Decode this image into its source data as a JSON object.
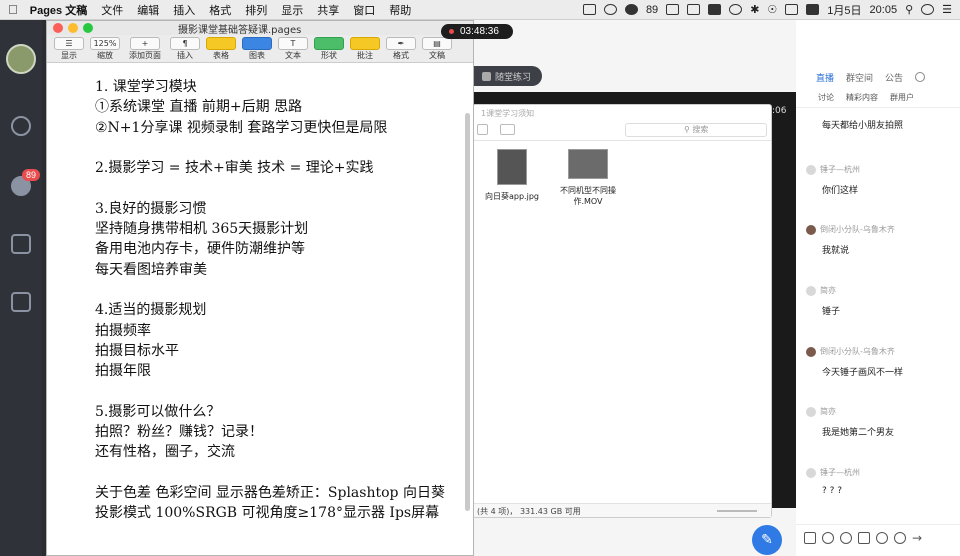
{
  "menubar": {
    "app": "Pages 文稿",
    "items": [
      "文件",
      "编辑",
      "插入",
      "格式",
      "排列",
      "显示",
      "共享",
      "窗口",
      "帮助"
    ],
    "battery_label": "89",
    "date": "1月5日",
    "time": "20:05"
  },
  "recording": {
    "time": "03:48:36"
  },
  "pages": {
    "title": "摄影课堂基础答疑课.pages",
    "zoom": "125%",
    "toolbar": [
      "显示",
      "缩放",
      "添加页面",
      "插入",
      "表格",
      "图表",
      "文本",
      "形状",
      "批注",
      "格式",
      "文稿"
    ],
    "lines": [
      "1. 课堂学习模块",
      "①系统课堂  直播  前期+后期  思路",
      "②N+1分享课  视频录制  套路学习更快但是局限",
      "",
      "2.摄影学习 = 技术+审美   技术 = 理论+实践",
      "",
      "3.良好的摄影习惯",
      "坚持随身携带相机   365天摄影计划",
      "备用电池内存卡，硬件防潮维护等",
      "每天看图培养审美",
      "",
      "4.适当的摄影规划",
      "拍摄频率",
      "拍摄目标水平",
      "拍摄年限",
      "",
      "5.摄影可以做什么？",
      "拍照？粉丝？赚钱？记录！",
      "还有性格，圈子，交流",
      "",
      "关于色差  色彩空间  显示器色差矫正：Splashtop 向日葵",
      "投影模式  100%SRGB  可视角度≥178°显示器  Ips屏幕"
    ]
  },
  "sidebar": {
    "badge": "89"
  },
  "classroom": {
    "practice_button": "随堂练习",
    "time_fragment": ":06"
  },
  "finder": {
    "title": "1课堂学习须知",
    "search_placeholder": "搜索",
    "files": [
      {
        "name": "向日葵app.jpg"
      },
      {
        "name": "不同机型不同操作.MOV"
      }
    ],
    "status": "(共 4 项)， 331.43 GB 可用"
  },
  "chat": {
    "tabs": [
      "直播",
      "群空间",
      "公告"
    ],
    "subtabs": [
      "讨论",
      "精彩内容",
      "群用户"
    ],
    "messages": [
      {
        "name": "",
        "text": "每天都给小朋友拍照"
      },
      {
        "name": "锤子—杭州",
        "text": "你们这样"
      },
      {
        "name": "倒闭小分队-乌鲁木齐",
        "text": "我就说"
      },
      {
        "name": "简亦",
        "text": "锤子"
      },
      {
        "name": "倒闭小分队-乌鲁木齐",
        "text": "今天锤子画风不一样"
      },
      {
        "name": "简亦",
        "text": "我是她第二个男友"
      },
      {
        "name": "锤子—杭州",
        "text": "? ? ?"
      }
    ]
  }
}
